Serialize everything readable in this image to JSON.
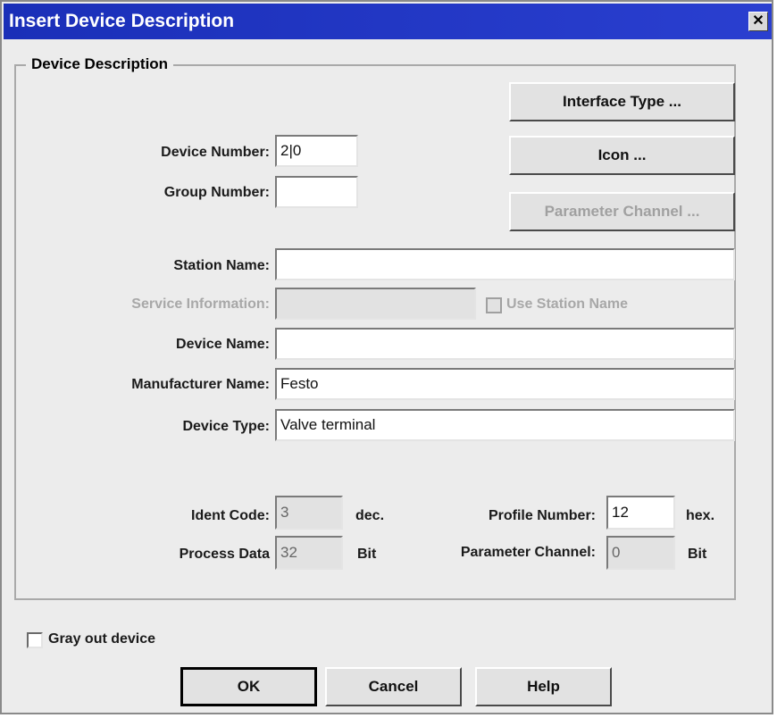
{
  "window": {
    "title": "Insert Device Description",
    "close": "✕"
  },
  "group": {
    "label": "Device Description"
  },
  "buttons": {
    "interface_type": "Interface Type ...",
    "icon": "Icon ...",
    "parameter_channel": "Parameter Channel ...",
    "ok": "OK",
    "cancel": "Cancel",
    "help": "Help"
  },
  "fields": {
    "device_number": {
      "label": "Device Number:",
      "value": "2|0"
    },
    "group_number": {
      "label": "Group Number:",
      "value": ""
    },
    "station_name": {
      "label": "Station Name:",
      "value": ""
    },
    "service_information": {
      "label": "Service Information:",
      "value": ""
    },
    "use_station_name": {
      "label": "Use Station Name",
      "checked": false
    },
    "device_name": {
      "label": "Device Name:",
      "value": ""
    },
    "manufacturer_name": {
      "label": "Manufacturer Name:",
      "value": "Festo"
    },
    "device_type": {
      "label": "Device Type:",
      "value": "Valve terminal"
    },
    "ident_code": {
      "label": "Ident Code:",
      "value": "3",
      "unit": "dec."
    },
    "process_data": {
      "label": "Process Data",
      "value": "32",
      "unit": "Bit"
    },
    "profile_number": {
      "label": "Profile Number:",
      "value": "12",
      "unit": "hex."
    },
    "parameter_channel": {
      "label": "Parameter Channel:",
      "value": "0",
      "unit": "Bit"
    }
  },
  "gray_out": {
    "label": "Gray out device",
    "checked": false
  },
  "colors": {
    "titlebar": "#1a2fb8",
    "dialog_bg": "#ececec",
    "disabled_text": "#a8a8a8"
  }
}
